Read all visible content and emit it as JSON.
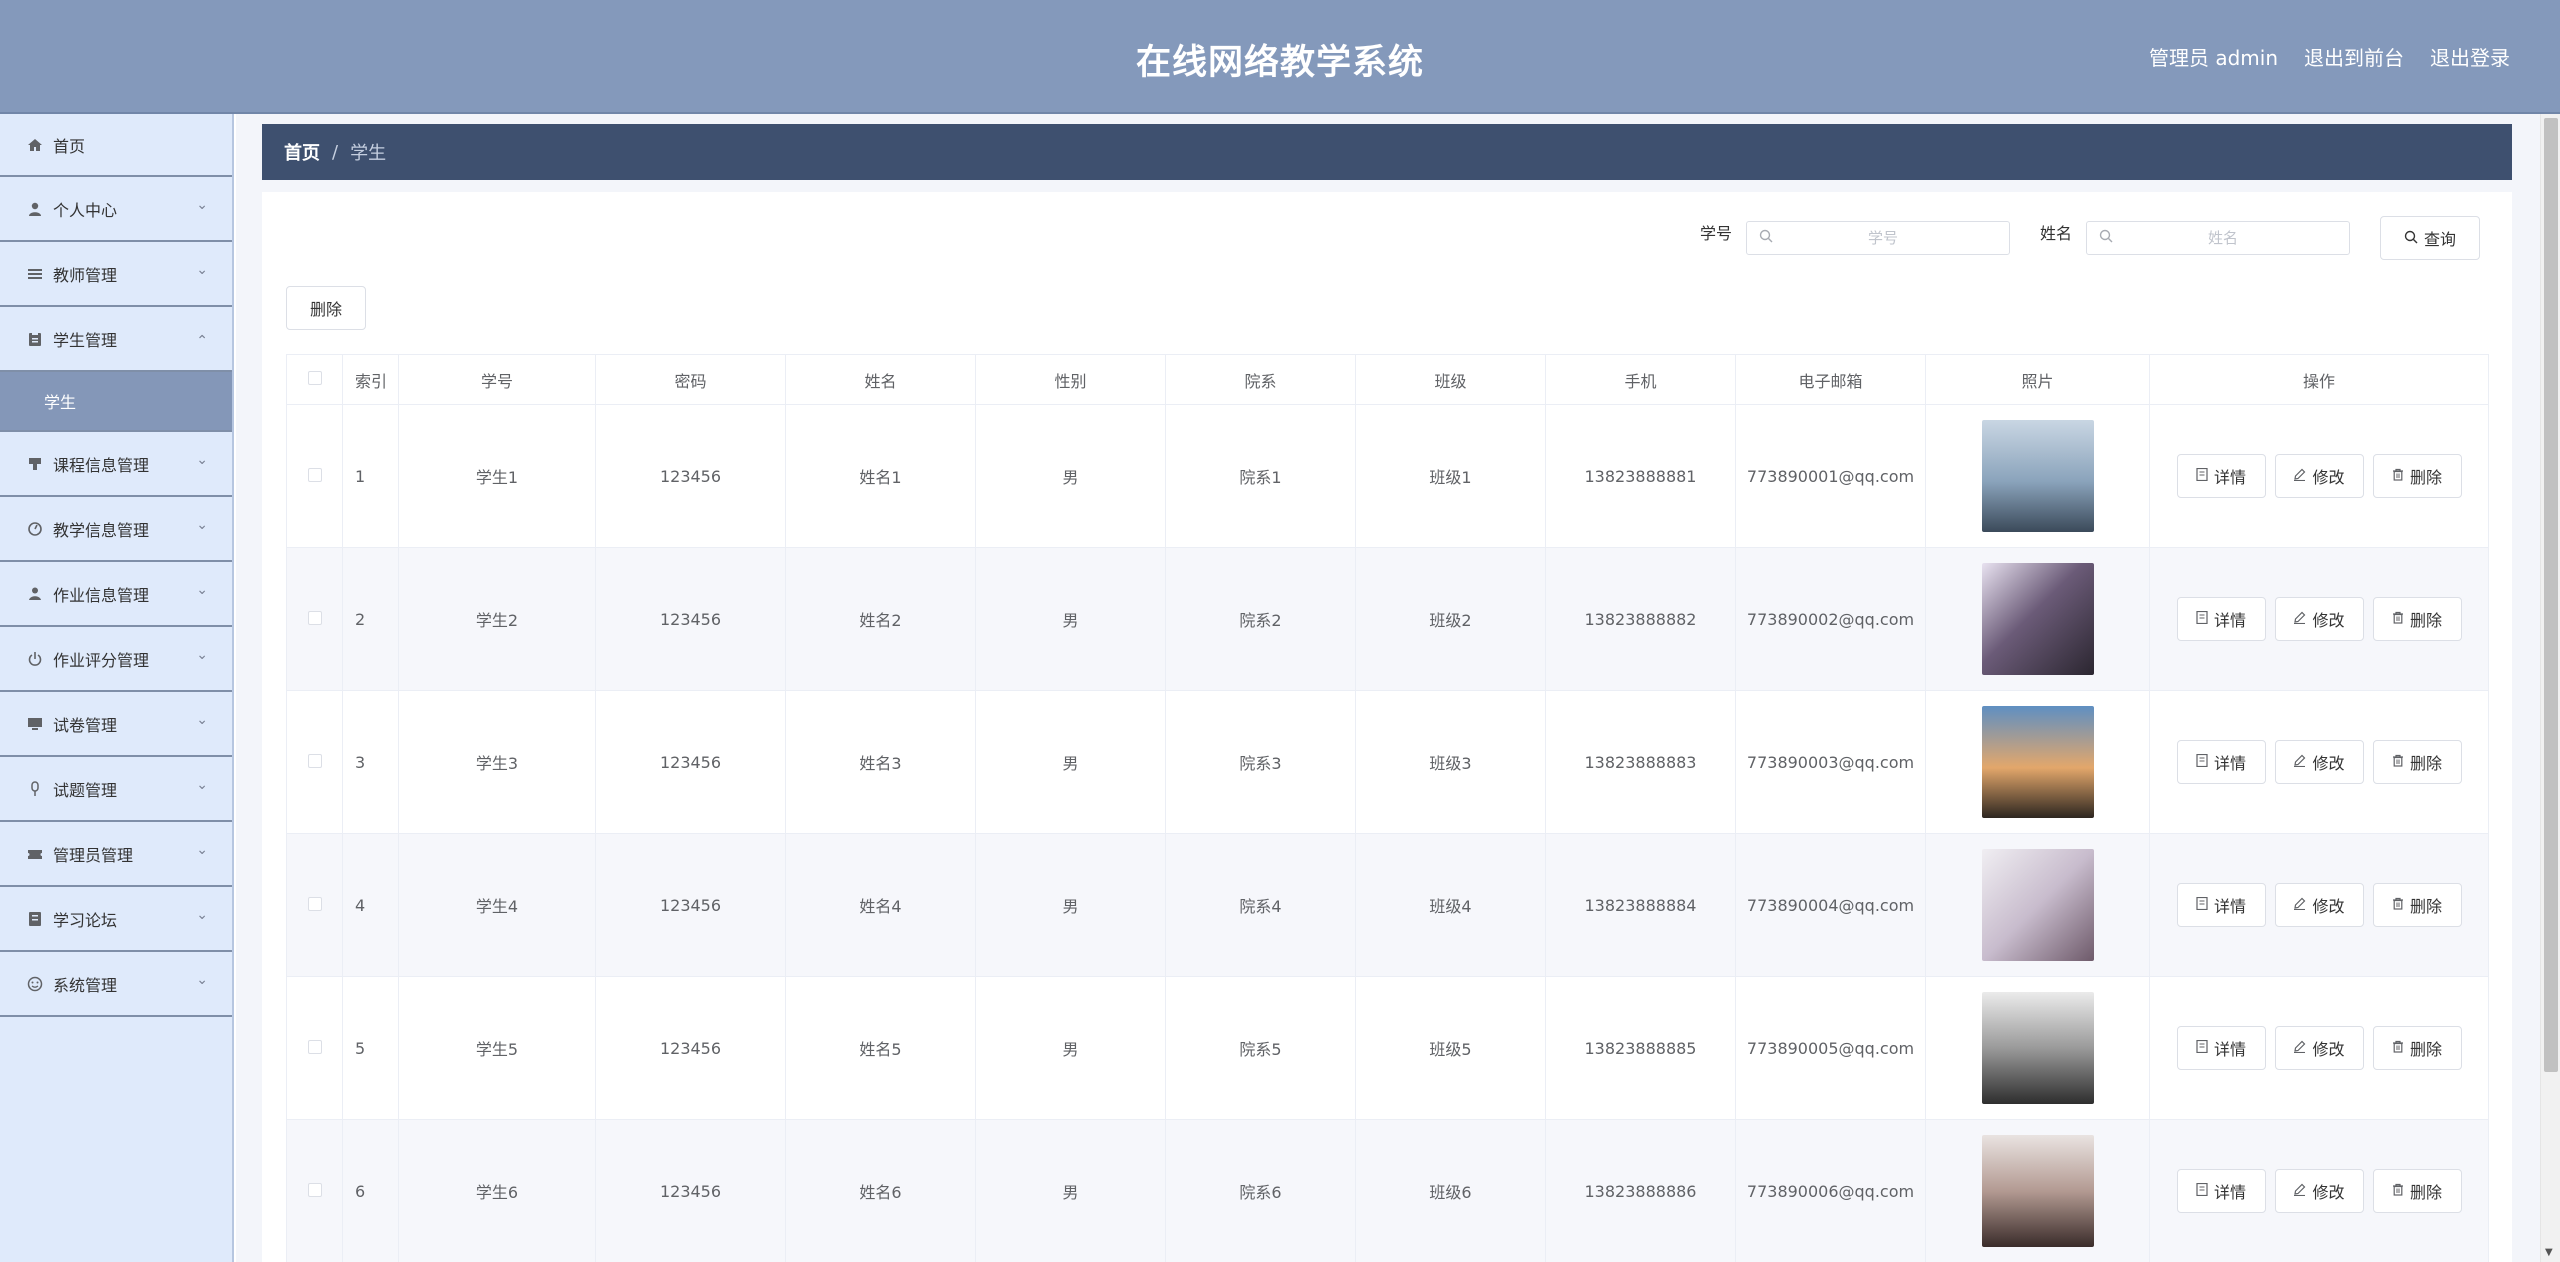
{
  "header": {
    "title": "在线网络教学系统",
    "admin_label": "管理员 admin",
    "exit_front": "退出到前台",
    "logout": "退出登录"
  },
  "sidebar": {
    "items": [
      {
        "label": "首页",
        "icon": "home-icon",
        "expandable": false
      },
      {
        "label": "个人中心",
        "icon": "user-icon",
        "expandable": true
      },
      {
        "label": "教师管理",
        "icon": "list-icon",
        "expandable": true
      },
      {
        "label": "学生管理",
        "icon": "clipboard-icon",
        "expandable": true,
        "expanded": true,
        "sub": "学生"
      },
      {
        "label": "课程信息管理",
        "icon": "stamp-icon",
        "expandable": true
      },
      {
        "label": "教学信息管理",
        "icon": "gauge-icon",
        "expandable": true
      },
      {
        "label": "作业信息管理",
        "icon": "person-icon",
        "expandable": true
      },
      {
        "label": "作业评分管理",
        "icon": "power-icon",
        "expandable": true
      },
      {
        "label": "试卷管理",
        "icon": "monitor-icon",
        "expandable": true
      },
      {
        "label": "试题管理",
        "icon": "mic-icon",
        "expandable": true
      },
      {
        "label": "管理员管理",
        "icon": "ticket-icon",
        "expandable": true
      },
      {
        "label": "学习论坛",
        "icon": "notebook-icon",
        "expandable": true
      },
      {
        "label": "系统管理",
        "icon": "smile-icon",
        "expandable": true
      }
    ]
  },
  "breadcrumb": {
    "home": "首页",
    "separator": "/",
    "current": "学生"
  },
  "search": {
    "field1_label": "学号",
    "field1_placeholder": "学号",
    "field2_label": "姓名",
    "field2_placeholder": "姓名",
    "query_label": "查询"
  },
  "toolbar": {
    "delete_label": "删除"
  },
  "table": {
    "headers": [
      "索引",
      "学号",
      "密码",
      "姓名",
      "性别",
      "院系",
      "班级",
      "手机",
      "电子邮箱",
      "照片",
      "操作"
    ],
    "actions": {
      "detail": "详情",
      "edit": "修改",
      "delete": "删除"
    },
    "rows": [
      {
        "index": "1",
        "student_id": "学生1",
        "password": "123456",
        "name": "姓名1",
        "gender": "男",
        "dept": "院系1",
        "class": "班级1",
        "phone": "13823888881",
        "email": "773890001@qq.com"
      },
      {
        "index": "2",
        "student_id": "学生2",
        "password": "123456",
        "name": "姓名2",
        "gender": "男",
        "dept": "院系2",
        "class": "班级2",
        "phone": "13823888882",
        "email": "773890002@qq.com"
      },
      {
        "index": "3",
        "student_id": "学生3",
        "password": "123456",
        "name": "姓名3",
        "gender": "男",
        "dept": "院系3",
        "class": "班级3",
        "phone": "13823888883",
        "email": "773890003@qq.com"
      },
      {
        "index": "4",
        "student_id": "学生4",
        "password": "123456",
        "name": "姓名4",
        "gender": "男",
        "dept": "院系4",
        "class": "班级4",
        "phone": "13823888884",
        "email": "773890004@qq.com"
      },
      {
        "index": "5",
        "student_id": "学生5",
        "password": "123456",
        "name": "姓名5",
        "gender": "男",
        "dept": "院系5",
        "class": "班级5",
        "phone": "13823888885",
        "email": "773890005@qq.com"
      },
      {
        "index": "6",
        "student_id": "学生6",
        "password": "123456",
        "name": "姓名6",
        "gender": "男",
        "dept": "院系6",
        "class": "班级6",
        "phone": "13823888886",
        "email": "773890006@qq.com"
      }
    ]
  },
  "colors": {
    "header_bg": "#8499bb",
    "sidebar_bg": "#dfeafb",
    "sidebar_active": "#8497b8",
    "breadcrumb_bg": "#3e506f"
  }
}
